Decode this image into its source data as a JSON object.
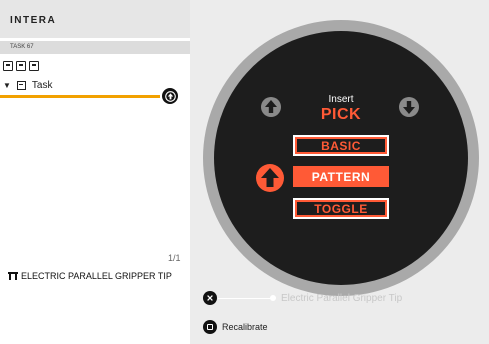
{
  "app": {
    "title": "INTERA"
  },
  "task": {
    "id_label": "TASK 67"
  },
  "tree": {
    "node_label": "Task"
  },
  "pagination": {
    "text": "1/1"
  },
  "tool": {
    "name": "ELECTRIC PARALLEL GRIPPER TIP"
  },
  "wheel": {
    "header": "Insert",
    "title": "PICK",
    "options": [
      "BASIC",
      "PATTERN",
      "TOGGLE"
    ],
    "selected": "PATTERN"
  },
  "footer": {
    "gripper_label": "Electric Parallel Gripper Tip",
    "recalibrate_label": "Recalibrate"
  },
  "colors": {
    "accent": "#ff5a36",
    "insert_line": "#f2a100",
    "wheel_dark": "#1d1d1d",
    "wheel_ring": "#a9a9a9"
  },
  "icons": [
    "toolbar-icon",
    "caret-down-icon",
    "task-node-icon",
    "insert-marker-icon",
    "up-arrow-icon",
    "down-arrow-icon",
    "selector-arrow-icon",
    "close-icon",
    "stop-icon",
    "gripper-icon"
  ]
}
